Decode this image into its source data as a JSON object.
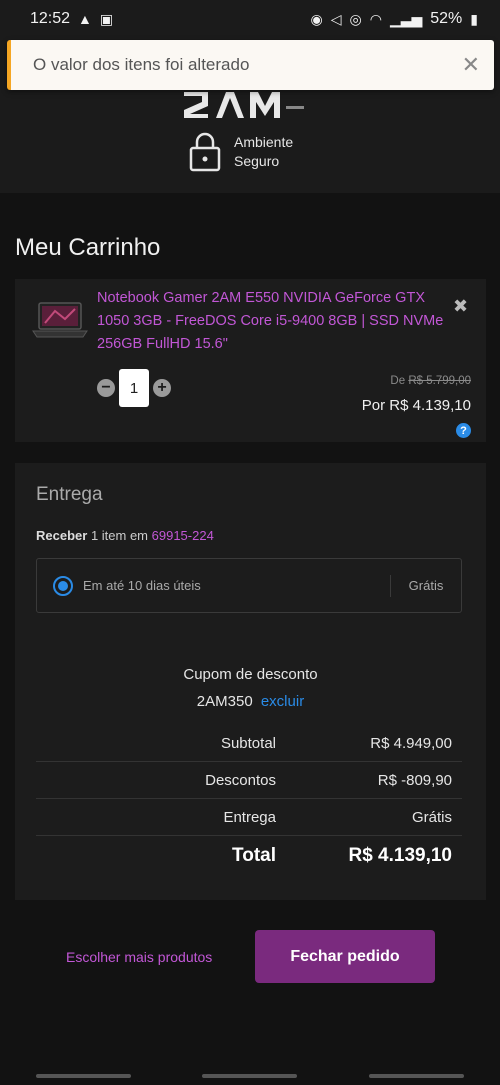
{
  "status_bar": {
    "time": "12:52",
    "battery": "52%",
    "left_icons": [
      "warning-icon",
      "image-icon"
    ],
    "right_icons": [
      "alarm-icon",
      "mute-icon",
      "hotspot-icon",
      "wifi-icon",
      "signal-icon",
      "battery-icon"
    ]
  },
  "toast": {
    "message": "O valor dos itens foi alterado",
    "accent_color": "#f5a623"
  },
  "header": {
    "secure_label_line1": "Ambiente",
    "secure_label_line2": "Seguro"
  },
  "cart": {
    "title": "Meu Carrinho",
    "item": {
      "name": "Notebook Gamer 2AM E550 NVIDIA GeForce GTX 1050 3GB - FreeDOS Core i5-9400 8GB | SSD NVMe 256GB FullHD 15.6\"",
      "quantity": "1",
      "price_old_prefix": "De",
      "price_old": "R$ 5.799,00",
      "price_now": "Por R$ 4.139,10",
      "help_label": "?"
    }
  },
  "delivery": {
    "title": "Entrega",
    "receive_prefix": "Receber",
    "receive_text": "1 item em",
    "zip": "69915-224",
    "option_label": "Em até 10 dias úteis",
    "option_price": "Grátis"
  },
  "coupon": {
    "title": "Cupom de desconto",
    "code": "2AM350",
    "remove_label": "excluir"
  },
  "totals": {
    "rows": [
      {
        "label": "Subtotal",
        "value": "R$ 4.949,00"
      },
      {
        "label": "Descontos",
        "value": "R$ -809,90"
      },
      {
        "label": "Entrega",
        "value": "Grátis"
      }
    ],
    "total_label": "Total",
    "total_value": "R$ 4.139,10"
  },
  "actions": {
    "continue_label": "Escolher mais produtos",
    "checkout_label": "Fechar pedido"
  },
  "colors": {
    "accent_purple": "#c257d6",
    "button_purple": "#7a2a7e",
    "link_blue": "#2a8be6"
  }
}
